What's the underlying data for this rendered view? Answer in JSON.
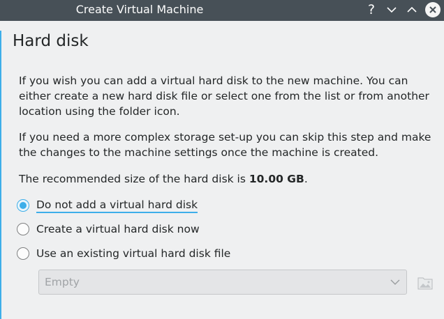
{
  "window": {
    "title": "Create Virtual Machine",
    "help_label": "?"
  },
  "page": {
    "heading": "Hard disk",
    "paragraph1": "If you wish you can add a virtual hard disk to the new machine. You can either create a new hard disk file or select one from the list or from another location using the folder icon.",
    "paragraph2": "If you need a more complex storage set-up you can skip this step and make the changes to the machine settings once the machine is created.",
    "recommended_prefix": "The recommended size of the hard disk is ",
    "recommended_size": "10.00 GB",
    "recommended_suffix": "."
  },
  "options": [
    {
      "label": "Do not add a virtual hard disk",
      "checked": true
    },
    {
      "label": "Create a virtual hard disk now",
      "checked": false
    },
    {
      "label": "Use an existing virtual hard disk file",
      "checked": false
    }
  ],
  "disk_select": {
    "value": "Empty",
    "enabled": false
  },
  "colors": {
    "titlebar": "#475057",
    "accent": "#3daee9",
    "background": "#eff0f1"
  },
  "icons": {
    "help": "help-icon",
    "minimize": "minimize-icon",
    "maximize": "maximize-icon",
    "close": "close-icon",
    "dropdown": "chevron-down-icon",
    "folder": "folder-icon"
  }
}
